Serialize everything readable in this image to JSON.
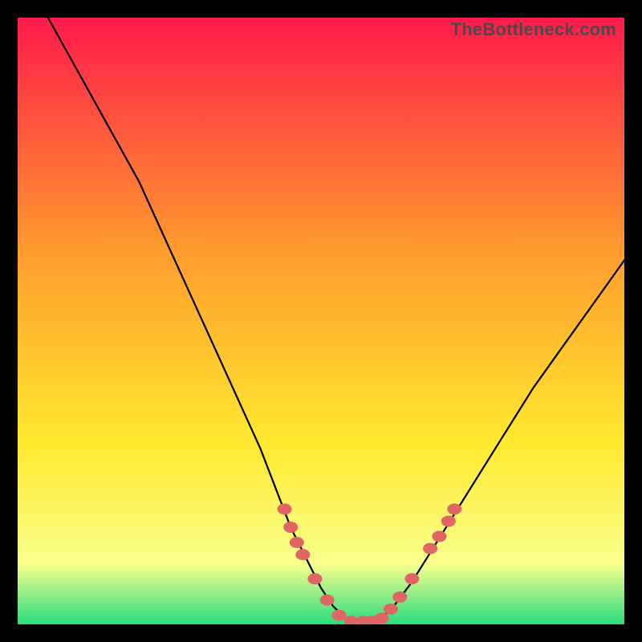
{
  "watermark": "TheBottleneck.com",
  "colors": {
    "frame": "#000000",
    "gradient_top": "#ff1a4b",
    "gradient_mid1": "#ff9a2e",
    "gradient_mid2": "#ffe92e",
    "gradient_low": "#f8ff8c",
    "gradient_bottom": "#2bdc7f",
    "curve": "#000000",
    "dot": "#e06666"
  },
  "chart_data": {
    "type": "line",
    "title": "",
    "xlabel": "",
    "ylabel": "",
    "xlim": [
      0,
      100
    ],
    "ylim": [
      0,
      100
    ],
    "series": [
      {
        "name": "bottleneck-curve",
        "x": [
          0,
          5,
          10,
          15,
          20,
          25,
          30,
          35,
          40,
          45,
          48,
          50,
          52,
          54,
          56,
          58,
          60,
          62,
          65,
          70,
          75,
          80,
          85,
          90,
          95,
          100
        ],
        "values": [
          110,
          100,
          91,
          82,
          73,
          62,
          51,
          40,
          29,
          16,
          10,
          6,
          3,
          1,
          0,
          0,
          1,
          3,
          7,
          15,
          23,
          31,
          39,
          46,
          53,
          60
        ]
      }
    ],
    "dots": {
      "name": "highlight-dots",
      "points": [
        {
          "x": 44.0,
          "y": 19.0
        },
        {
          "x": 45.0,
          "y": 16.0
        },
        {
          "x": 46.0,
          "y": 13.5
        },
        {
          "x": 47.0,
          "y": 11.5
        },
        {
          "x": 49.0,
          "y": 7.5
        },
        {
          "x": 51.0,
          "y": 4.0
        },
        {
          "x": 53.0,
          "y": 1.5
        },
        {
          "x": 55.0,
          "y": 0.5
        },
        {
          "x": 57.0,
          "y": 0.5
        },
        {
          "x": 58.5,
          "y": 0.5
        },
        {
          "x": 60.0,
          "y": 1.0
        },
        {
          "x": 61.5,
          "y": 2.5
        },
        {
          "x": 63.0,
          "y": 4.5
        },
        {
          "x": 65.0,
          "y": 7.5
        },
        {
          "x": 68.0,
          "y": 12.5
        },
        {
          "x": 69.5,
          "y": 14.5
        },
        {
          "x": 71.0,
          "y": 17.0
        },
        {
          "x": 72.0,
          "y": 19.0
        }
      ]
    }
  }
}
